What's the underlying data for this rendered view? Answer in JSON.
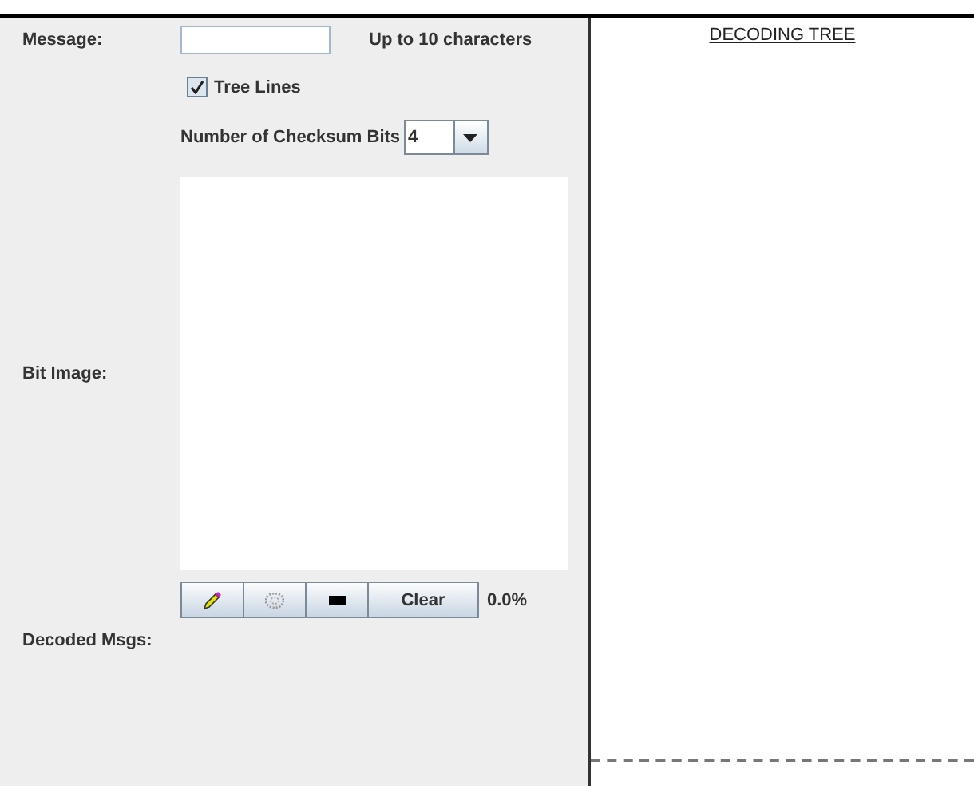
{
  "message": {
    "label": "Message:",
    "hint": "Up to 10 characters"
  },
  "tree_lines": {
    "label": "Tree Lines",
    "checked": true
  },
  "checksum_bits": {
    "label": "Number of Checksum Bits",
    "value": "4"
  },
  "bit_image": {
    "label": "Bit Image:"
  },
  "tools": [
    {
      "kind": "pencil"
    },
    {
      "kind": "spray"
    },
    {
      "kind": "block"
    },
    {
      "kind": "clear",
      "label": "Clear"
    }
  ],
  "fill_percent": "0.0%",
  "decoded": {
    "label": "Decoded Msgs:"
  },
  "tree": {
    "title": "DECODING TREE"
  }
}
